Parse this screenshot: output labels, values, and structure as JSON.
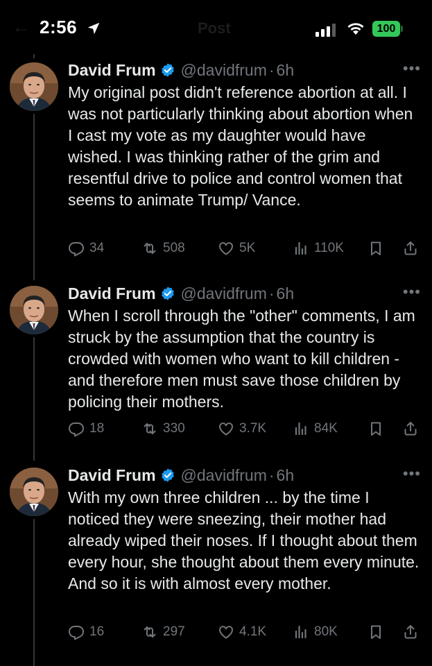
{
  "status_bar": {
    "time": "2:56",
    "faded_title": "Post",
    "battery": "100"
  },
  "posts": [
    {
      "author": "David Frum",
      "handle": "@davidfrum",
      "separator": "·",
      "time": "6h",
      "text": "My original post didn't reference abortion at all. I was not particularly thinking about abortion when I cast my vote as my daughter would have wished. I was thinking rather of the grim and resentful drive to police and control women that seems to animate Trump/ Vance.",
      "replies": "34",
      "reposts": "508",
      "likes": "5K",
      "views": "110K"
    },
    {
      "author": "David Frum",
      "handle": "@davidfrum",
      "separator": "·",
      "time": "6h",
      "text": "When I scroll through the \"other\" comments, I am struck by the assumption that the country is crowded with women who want to kill children - and therefore men must save those children by policing their mothers.",
      "replies": "18",
      "reposts": "330",
      "likes": "3.7K",
      "views": "84K"
    },
    {
      "author": "David Frum",
      "handle": "@davidfrum",
      "separator": "·",
      "time": "6h",
      "text": "With my own three children ... by the time I noticed they were sneezing, their mother had already wiped their noses. If I thought about them every hour, she thought about them every minute. And so it is with almost every mother.",
      "replies": "16",
      "reposts": "297",
      "likes": "4.1K",
      "views": "80K"
    }
  ],
  "colors": {
    "background": "#000000",
    "text": "#e7e9ea",
    "muted": "#71767b",
    "verified": "#1d9bf0",
    "battery": "#34c759"
  }
}
